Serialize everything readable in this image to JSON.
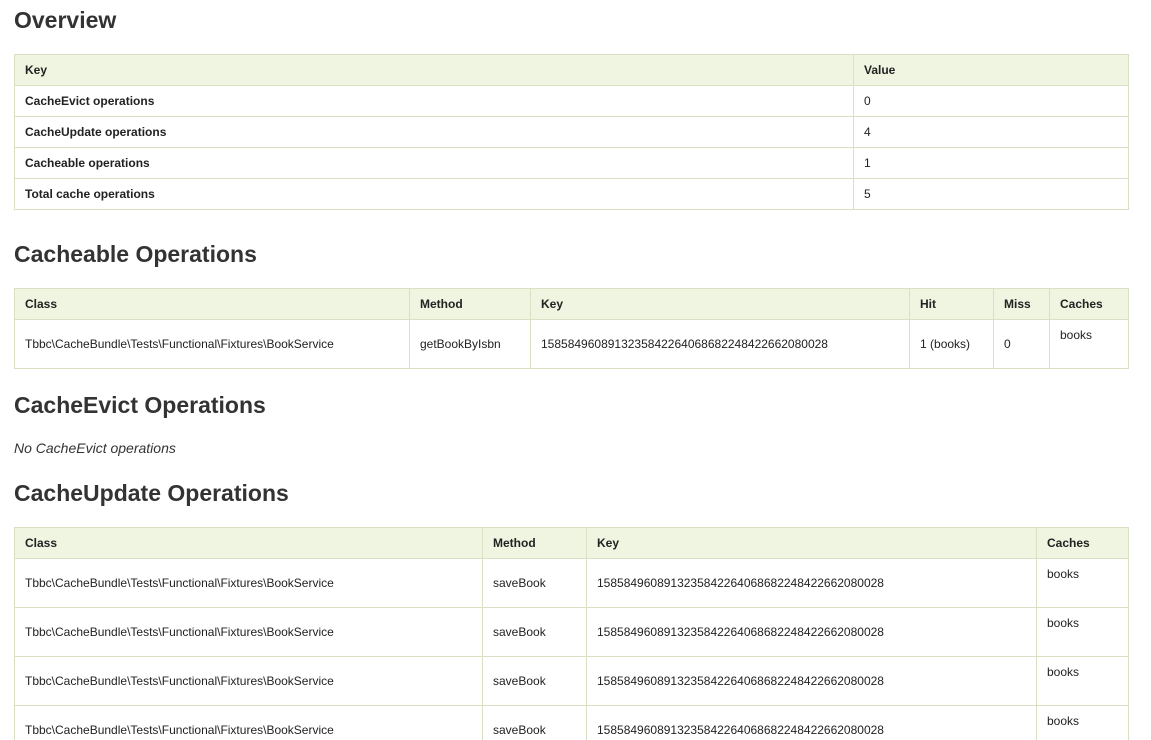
{
  "overview": {
    "title": "Overview",
    "headers": [
      "Key",
      "Value"
    ],
    "rows": [
      {
        "key": "CacheEvict operations",
        "value": "0"
      },
      {
        "key": "CacheUpdate operations",
        "value": "4"
      },
      {
        "key": "Cacheable operations",
        "value": "1"
      },
      {
        "key": "Total cache operations",
        "value": "5"
      }
    ]
  },
  "cacheable": {
    "title": "Cacheable Operations",
    "headers": [
      "Class",
      "Method",
      "Key",
      "Hit",
      "Miss",
      "Caches"
    ],
    "rows": [
      {
        "class": "Tbbc\\CacheBundle\\Tests\\Functional\\Fixtures\\BookService",
        "method": "getBookByIsbn",
        "key": "1585849608913235842264068682248422662080028",
        "hit_count": "1",
        "hit_cache": "(books)",
        "miss": "0",
        "caches": "books"
      }
    ]
  },
  "evict": {
    "title": "CacheEvict Operations",
    "empty": "No CacheEvict operations"
  },
  "update": {
    "title": "CacheUpdate Operations",
    "headers": [
      "Class",
      "Method",
      "Key",
      "Caches"
    ],
    "rows": [
      {
        "class": "Tbbc\\CacheBundle\\Tests\\Functional\\Fixtures\\BookService",
        "method": "saveBook",
        "key": "1585849608913235842264068682248422662080028",
        "caches": "books"
      },
      {
        "class": "Tbbc\\CacheBundle\\Tests\\Functional\\Fixtures\\BookService",
        "method": "saveBook",
        "key": "1585849608913235842264068682248422662080028",
        "caches": "books"
      },
      {
        "class": "Tbbc\\CacheBundle\\Tests\\Functional\\Fixtures\\BookService",
        "method": "saveBook",
        "key": "1585849608913235842264068682248422662080028",
        "caches": "books"
      },
      {
        "class": "Tbbc\\CacheBundle\\Tests\\Functional\\Fixtures\\BookService",
        "method": "saveBook",
        "key": "1585849608913235842264068682248422662080028",
        "caches": "books"
      }
    ]
  }
}
